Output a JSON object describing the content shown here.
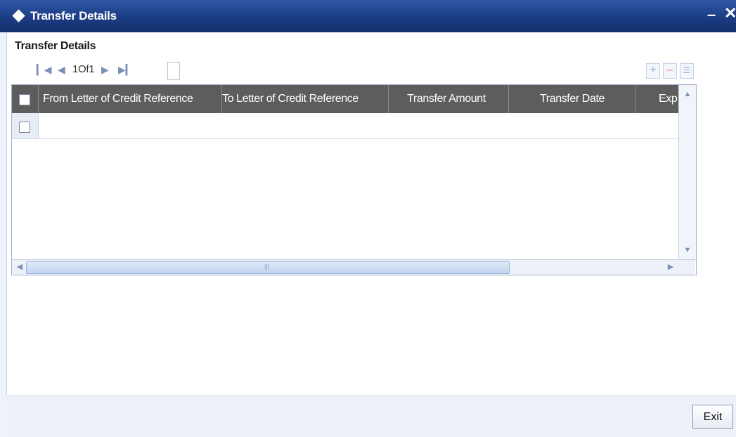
{
  "window": {
    "title": "Transfer Details",
    "minimize_symbol": "–",
    "close_symbol": "✕"
  },
  "section": {
    "title": "Transfer Details"
  },
  "navigation": {
    "first_icon": "first-page-icon",
    "prev_icon": "previous-page-icon",
    "page_text": "1Of1",
    "next_icon": "next-page-icon",
    "last_icon": "last-page-icon",
    "page_input_value": ""
  },
  "toolbar": {
    "add_icon": "plus-icon",
    "delete_icon": "minus-icon",
    "view_icon": "list-view-icon"
  },
  "grid": {
    "columns": [
      "From Letter of Credit Reference",
      "To Letter of Credit Reference",
      "Transfer Amount",
      "Transfer Date",
      "Exp"
    ],
    "rows": [
      {
        "checked": false,
        "cells": [
          "",
          "",
          "",
          "",
          ""
        ]
      }
    ]
  },
  "footer": {
    "exit_label": "Exit"
  },
  "colors": {
    "titlebar": "#1b3c84",
    "header": "#5d5d5d",
    "footer": "#eef2f8"
  }
}
